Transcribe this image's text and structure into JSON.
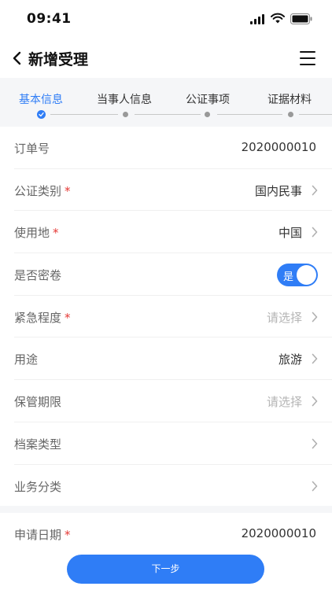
{
  "status_bar": {
    "time": "09:41"
  },
  "nav": {
    "title": "新增受理"
  },
  "steps": [
    {
      "label": "基本信息",
      "active": true
    },
    {
      "label": "当事人信息",
      "active": false
    },
    {
      "label": "公证事项",
      "active": false
    },
    {
      "label": "证据材料",
      "active": false
    }
  ],
  "form": {
    "rows": [
      {
        "label": "订单号",
        "required": false,
        "value": "2020000010",
        "type": "text"
      },
      {
        "label": "公证类别",
        "required": true,
        "value": "国内民事",
        "type": "select"
      },
      {
        "label": "使用地",
        "required": true,
        "value": "中国",
        "type": "select"
      },
      {
        "label": "是否密卷",
        "required": false,
        "value": "是",
        "type": "toggle",
        "on": true
      },
      {
        "label": "紧急程度",
        "required": true,
        "value": "",
        "placeholder": "请选择",
        "type": "select"
      },
      {
        "label": "用途",
        "required": false,
        "value": "旅游",
        "type": "select"
      },
      {
        "label": "保管期限",
        "required": false,
        "value": "",
        "placeholder": "请选择",
        "type": "select"
      },
      {
        "label": "档案类型",
        "required": false,
        "value": "",
        "type": "select"
      },
      {
        "label": "业务分类",
        "required": false,
        "value": "",
        "type": "select"
      }
    ],
    "date_row": {
      "label": "申请日期",
      "required": true,
      "value": "2020000010"
    },
    "required_mark": "*"
  },
  "footer": {
    "next_label": "下一步"
  },
  "colors": {
    "accent": "#2f7df6",
    "required": "#e53935",
    "placeholder": "#b5b5b5",
    "section_bg": "#f5f6f8"
  },
  "icons": {
    "back": "chevron-left-icon",
    "menu": "hamburger-menu-icon",
    "row": "chevron-right-icon"
  }
}
